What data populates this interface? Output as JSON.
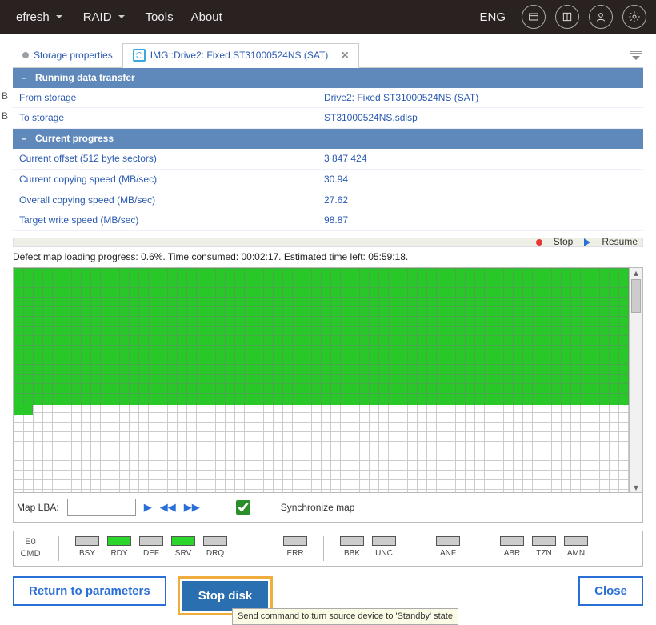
{
  "menu": {
    "refresh": "efresh",
    "raid": "RAID",
    "tools": "Tools",
    "about": "About",
    "lang": "ENG"
  },
  "tabs": {
    "storage": "Storage properties",
    "drive": "IMG::Drive2: Fixed ST31000524NS (SAT)"
  },
  "sec1": {
    "title": "Running data transfer",
    "from_k": "From storage",
    "from_v": "Drive2: Fixed ST31000524NS (SAT)",
    "to_k": "To storage",
    "to_v": "ST31000524NS.sdlsp"
  },
  "sec2": {
    "title": "Current progress",
    "off_k": "Current offset (512 byte sectors)",
    "off_v": "3 847 424",
    "ccs_k": "Current copying speed (MB/sec)",
    "ccs_v": "30.94",
    "ocs_k": "Overall copying speed (MB/sec)",
    "ocs_v": "27.62",
    "tws_k": "Target write speed (MB/sec)",
    "tws_v": "98.87"
  },
  "ctrls": {
    "stop": "Stop",
    "resume": "Resume"
  },
  "defect": "Defect map loading progress: 0.6%. Time consumed: 00:02:17. Estimated time left: 05:59:18.",
  "maplba": {
    "label": "Map LBA:",
    "sync": "Synchronize map"
  },
  "leds": {
    "e0a": "E0",
    "e0b": "CMD",
    "bsy": "BSY",
    "rdy": "RDY",
    "def": "DEF",
    "srv": "SRV",
    "drq": "DRQ",
    "err": "ERR",
    "bbk": "BBK",
    "unc": "UNC",
    "anf": "ANF",
    "abr": "ABR",
    "tzn": "TZN",
    "amn": "AMN"
  },
  "buttons": {
    "return": "Return to parameters",
    "stopdisk": "Stop disk",
    "close": "Close"
  },
  "tooltip": "Send command to turn source device to 'Standby' state",
  "sidebig": "B"
}
